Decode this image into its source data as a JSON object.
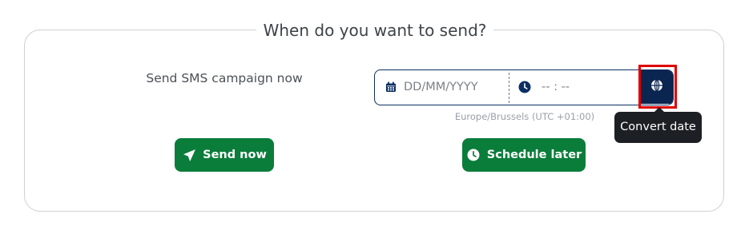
{
  "section": {
    "title": "When do you want to send?",
    "send_now_label": "Send SMS campaign now"
  },
  "schedule": {
    "date_placeholder": "DD/MM/YYYY",
    "date_icon": "calendar-icon",
    "time_placeholder": "-- : --",
    "time_icon": "clock-icon",
    "timezone_icon": "globe-icon",
    "timezone_text": "Europe/Brussels (UTC +01:00)",
    "tooltip": "Convert date"
  },
  "actions": {
    "send_now": {
      "label": "Send now",
      "icon": "paper-plane-icon"
    },
    "schedule_later": {
      "label": "Schedule later",
      "icon": "clock-icon"
    }
  },
  "colors": {
    "primary_green": "#0a7d3a",
    "navy": "#0a2550",
    "highlight_red": "#e00000",
    "tooltip_bg": "#1c1f23"
  }
}
